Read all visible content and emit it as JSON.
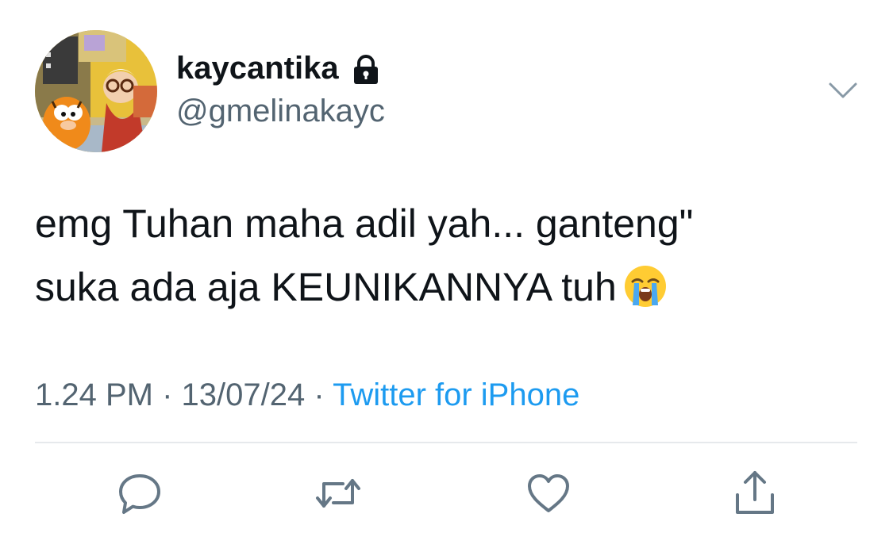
{
  "user": {
    "display_name": "kaycantika",
    "handle": "@gmelinakayc",
    "protected_icon": "lock-icon",
    "avatar": "garfield-cartoon-avatar"
  },
  "tweet": {
    "line1": "emg Tuhan maha adil yah... ganteng\"",
    "line2": "suka ada aja KEUNIKANNYA tuh",
    "emoji": "loudly-crying-face"
  },
  "meta": {
    "time": "1.24 PM",
    "separator": "·",
    "date": "13/07/24",
    "source": "Twitter for iPhone"
  },
  "actions": [
    "reply-icon",
    "retweet-icon",
    "like-icon",
    "share-icon"
  ],
  "colors": {
    "text": "#0f1419",
    "secondary": "#536471",
    "link": "#1d9bf0",
    "icon": "#657786",
    "divider": "#e6e9ec"
  }
}
